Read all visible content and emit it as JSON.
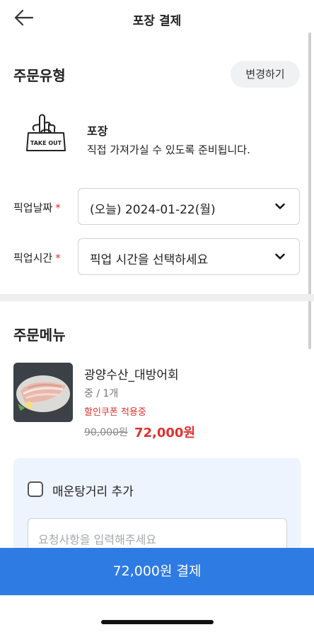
{
  "header": {
    "title": "포장 결제"
  },
  "order_type": {
    "section_title": "주문유형",
    "change_label": "변경하기",
    "icon_text": "TAKE OUT",
    "name": "포장",
    "description": "직접 가져가실 수 있도록 준비됩니다."
  },
  "pickup": {
    "date_label": "픽업날짜",
    "date_value": "(오늘) 2024-01-22(월)",
    "time_label": "픽업시간",
    "time_value": "픽업 시간을 선택하세요",
    "required_mark": "*"
  },
  "menu": {
    "section_title": "주문메뉴",
    "item": {
      "name": "광양수산_대방어회",
      "option": "중 / 1개",
      "coupon": "할인쿠폰 적용중",
      "original_price": "90,000원",
      "price": "72,000원"
    }
  },
  "extras": {
    "checkbox_label": "매운탕거리 추가",
    "checked": false,
    "request_placeholder": "요청사항을 입력해주세요"
  },
  "payment": {
    "button_label": "72,000원 결제"
  },
  "colors": {
    "accent": "#2f7be4",
    "sale": "#e0312f",
    "panel": "#eef4fd"
  }
}
